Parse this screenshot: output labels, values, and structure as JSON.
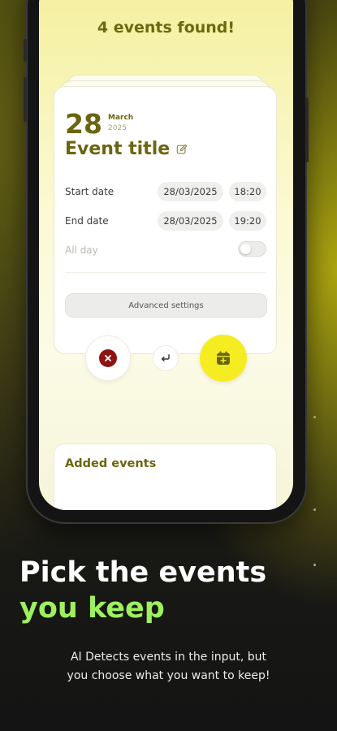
{
  "header": {
    "found_text": "4 events found!"
  },
  "event_card": {
    "day": "28",
    "month": "March",
    "year": "2025",
    "title": "Event title",
    "start": {
      "label": "Start date",
      "date": "28/03/2025",
      "time": "18:20"
    },
    "end": {
      "label": "End date",
      "date": "28/03/2025",
      "time": "19:20"
    },
    "all_day": {
      "label": "All day",
      "enabled": false
    },
    "advanced_button": "Advanced settings"
  },
  "actions": {
    "reject_icon": "close-icon",
    "skip_icon": "undo-icon",
    "keep_icon": "calendar-add-icon"
  },
  "added_section": {
    "label": "Added events"
  },
  "promo": {
    "line1": "Pick the events",
    "line2": "you keep",
    "caption_line1": "AI Detects events in the input, but",
    "caption_line2": "you choose what you want to keep!"
  },
  "colors": {
    "accent_yellow": "#f6ec22",
    "title_olive": "#6b6510",
    "headline_green": "#9ef05e",
    "reject_red": "#8e1414"
  }
}
